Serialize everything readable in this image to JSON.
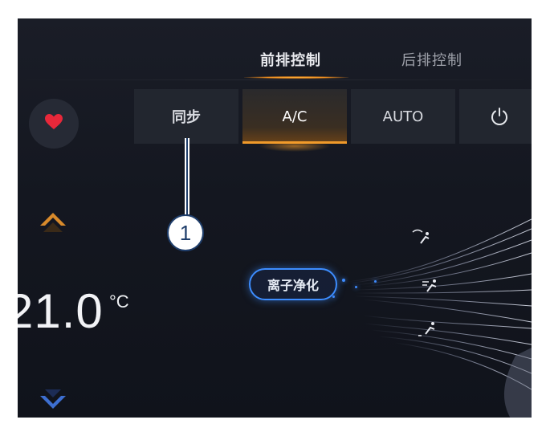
{
  "tabs": {
    "front_label": "前排控制",
    "rear_label": "后排控制"
  },
  "controls": {
    "sync_label": "同步",
    "ac_label": "A/C",
    "auto_label": "AUTO"
  },
  "temperature": {
    "value": "21.0",
    "unit": "°C"
  },
  "ion_purifier_label": "离子净化",
  "callout": {
    "number": "1"
  },
  "icons": {
    "favorite": "heart-icon",
    "power": "power-icon",
    "temp_up": "chevron-up-icon",
    "temp_down": "chevron-down-icon",
    "vent_top": "defrost-airflow-icon",
    "vent_face": "face-airflow-icon",
    "vent_foot": "foot-airflow-icon"
  },
  "colors": {
    "accent_orange": "#f09a2a",
    "ion_blue": "#3d8dff",
    "callout_blue": "#1f3e6b",
    "favorite_red": "#e8283a"
  }
}
